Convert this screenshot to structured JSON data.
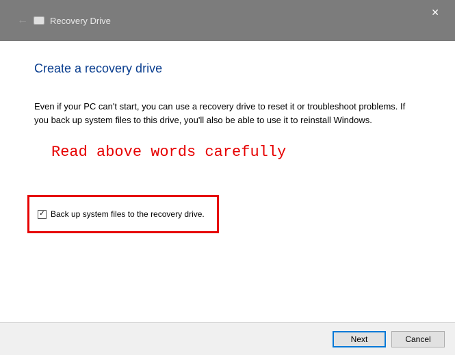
{
  "titlebar": {
    "title": "Recovery Drive",
    "close_symbol": "✕"
  },
  "content": {
    "heading": "Create a recovery drive",
    "description": "Even if your PC can't start, you can use a recovery drive to reset it or troubleshoot problems. If you back up system files to this drive, you'll also be able to use it to reinstall Windows.",
    "annotation": "Read above words carefully",
    "checkbox": {
      "checked_mark": "✓",
      "label": "Back up system files to the recovery drive."
    }
  },
  "footer": {
    "next_label": "Next",
    "cancel_label": "Cancel"
  }
}
